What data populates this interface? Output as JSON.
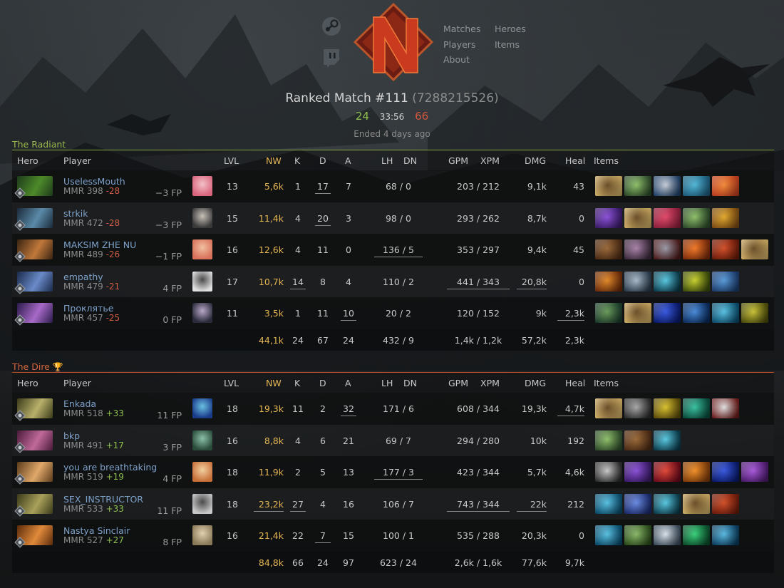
{
  "nav": {
    "left_icons": [
      "steam-icon",
      "twitch-icon"
    ],
    "col1": [
      "Matches",
      "Players",
      "About"
    ],
    "col2": [
      "Heroes",
      "Items"
    ]
  },
  "match": {
    "title_prefix": "Ranked Match #111",
    "match_id": "(7288215526)",
    "radiant_score": "24",
    "duration": "33:56",
    "dire_score": "66",
    "ended": "Ended 4 days ago"
  },
  "columns": {
    "hero": "Hero",
    "player": "Player",
    "lvl": "LVL",
    "nw": "NW",
    "k": "K",
    "d": "D",
    "a": "A",
    "lh": "LH",
    "dn": "DN",
    "gpm": "GPM",
    "xpm": "XPM",
    "dmg": "DMG",
    "heal": "Heal",
    "items": "Items"
  },
  "colors": {
    "radiant": "#8fbf4f",
    "dire": "#d0553f",
    "networth": "#e3b552",
    "player_link": "#7da0c9"
  },
  "teams": [
    {
      "key": "radiant",
      "name": "The Radiant",
      "winner": false,
      "players": [
        {
          "name": "UselessMouth",
          "mmr": "MMR 398",
          "delta": "-28",
          "fp": "−3 FP",
          "lvl": "13",
          "nw": "5,6k",
          "k": "1",
          "d": "17",
          "a": "7",
          "lhdn": "68 / 0",
          "gpmxpm": "203 / 212",
          "dmg": "9,1k",
          "heal": "43",
          "hero_colors": [
            "#1d3a1a",
            "#4d8a2a"
          ],
          "avatar_colors": [
            "#d9667d",
            "#f3c0c8"
          ],
          "items": [
            [
              "#c9a862",
              "#6b4f2a"
            ],
            [
              "#2d4a2a",
              "#8fbf6a"
            ],
            [
              "#1e3f66",
              "#c7ccd6"
            ],
            [
              "#1d5a7a",
              "#52b7d6"
            ],
            [
              "#b83c1e",
              "#f08a3a"
            ]
          ],
          "u": {
            "d": true
          }
        },
        {
          "name": "strkik",
          "mmr": "MMR 472",
          "delta": "-28",
          "fp": "−3 FP",
          "lvl": "15",
          "nw": "11,4k",
          "k": "4",
          "d": "20",
          "a": "3",
          "lhdn": "98 / 0",
          "gpmxpm": "293 / 262",
          "dmg": "8,7k",
          "heal": "0",
          "hero_colors": [
            "#1a2a3a",
            "#5a8aa8"
          ],
          "avatar_colors": [
            "#3a3a3a",
            "#c8c0b8"
          ],
          "items": [
            [
              "#3a1a66",
              "#8a52d6"
            ],
            [
              "#c9a862",
              "#6b4f2a"
            ],
            [
              "#8a1e3a",
              "#e04a6a"
            ],
            [
              "#2d4a2a",
              "#8fbf6a"
            ],
            [
              "#7a4a12",
              "#e0a830"
            ]
          ],
          "u": {
            "d": true
          }
        },
        {
          "name": "MAKSIM ZHE NU",
          "mmr": "MMR 489",
          "delta": "-26",
          "fp": "−1 FP",
          "lvl": "16",
          "nw": "12,6k",
          "k": "4",
          "d": "11",
          "a": "0",
          "lhdn": "136 / 5",
          "gpmxpm": "353 / 297",
          "dmg": "9,4k",
          "heal": "45",
          "hero_colors": [
            "#3a2412",
            "#c0783a"
          ],
          "avatar_colors": [
            "#d8705a",
            "#f1c0a0"
          ],
          "items": [
            [
              "#4a2a14",
              "#9a6a3a"
            ],
            [
              "#3a2a3a",
              "#a882a8"
            ],
            [
              "#4a1a1a",
              "#9a9aa8"
            ],
            [
              "#7a2a0a",
              "#f07a2a"
            ],
            [
              "#6a1a0a",
              "#d0502a"
            ],
            [
              "#c9a862",
              "#6b4f2a"
            ]
          ],
          "u": {
            "lh": true
          }
        },
        {
          "name": "empathy",
          "mmr": "MMR 479",
          "delta": "-21",
          "fp": "4 FP",
          "lvl": "17",
          "nw": "10,7k",
          "k": "14",
          "d": "8",
          "a": "4",
          "lhdn": "110 / 2",
          "gpmxpm": "441 / 343",
          "dmg": "20,8k",
          "heal": "0",
          "hero_colors": [
            "#1a2a4a",
            "#6a8ac8"
          ],
          "avatar_colors": [
            "#e0e0e0",
            "#4a4a4a"
          ],
          "items": [
            [
              "#6a2a0a",
              "#e08a2a"
            ],
            [
              "#2a3a4a",
              "#a8b8c8"
            ],
            [
              "#0a3a4a",
              "#5ac8e0"
            ],
            [
              "#3a4a0a",
              "#c8d030"
            ],
            [
              "#1a3a6a",
              "#5a9ad8"
            ]
          ],
          "u": {
            "k": true,
            "gpm": true,
            "dmg": true
          }
        },
        {
          "name": "Проклятье",
          "mmr": "MMR 457",
          "delta": "-25",
          "fp": "0 FP",
          "lvl": "11",
          "nw": "3,5k",
          "k": "1",
          "d": "11",
          "a": "10",
          "lhdn": "20 / 2",
          "gpmxpm": "120 / 152",
          "dmg": "9k",
          "heal": "2,3k",
          "hero_colors": [
            "#2a1a4a",
            "#a86ac8"
          ],
          "avatar_colors": [
            "#2a2a3a",
            "#b8a8c8"
          ],
          "items": [
            [
              "#1a3a2a",
              "#6a9a5a"
            ],
            [
              "#c9a862",
              "#6b4f2a"
            ],
            [
              "#0a1a6a",
              "#3a5ae0"
            ],
            [
              "#0a2a5a",
              "#4a8ad8"
            ],
            [
              "#0a4a6a",
              "#5ac0e0"
            ],
            [
              "#4a4a0a",
              "#c8c03a"
            ]
          ],
          "u": {
            "a": true,
            "heal": true
          }
        }
      ],
      "totals": {
        "nw": "44,1k",
        "k": "24",
        "d": "67",
        "a": "24",
        "lhdn": "432 / 9",
        "gpmxpm": "1,4k / 1,2k",
        "dmg": "57,2k",
        "heal": "2,3k"
      }
    },
    {
      "key": "dire",
      "name": "The Dire",
      "winner": true,
      "players": [
        {
          "name": "Enkada",
          "mmr": "MMR 518",
          "delta": "+33",
          "fp": "11 FP",
          "lvl": "18",
          "nw": "19,3k",
          "k": "11",
          "d": "2",
          "a": "32",
          "lhdn": "171 / 6",
          "gpmxpm": "608 / 344",
          "dmg": "19,3k",
          "heal": "4,7k",
          "hero_colors": [
            "#3a3a1a",
            "#b8b06a"
          ],
          "avatar_colors": [
            "#1a3a8a",
            "#6ac0e0"
          ],
          "items": [
            [
              "#c9a862",
              "#6b4f2a"
            ],
            [
              "#2a2a2a",
              "#a8a8a8"
            ],
            [
              "#5a4a0a",
              "#d8c030"
            ],
            [
              "#0a4a3a",
              "#3ac0a0"
            ],
            [
              "#6a1a1a",
              "#e0e0e0"
            ]
          ],
          "u": {
            "a": true,
            "heal": true
          }
        },
        {
          "name": "bkp",
          "mmr": "MMR 491",
          "delta": "+17",
          "fp": "3 FP",
          "lvl": "16",
          "nw": "8,8k",
          "k": "4",
          "d": "6",
          "a": "21",
          "lhdn": "69 / 7",
          "gpmxpm": "294 / 280",
          "dmg": "10k",
          "heal": "192",
          "hero_colors": [
            "#4a1a3a",
            "#c06a9a"
          ],
          "avatar_colors": [
            "#2a4a3a",
            "#8ac0a8"
          ],
          "items": [
            [
              "#2d4a2a",
              "#8fbf6a"
            ],
            [
              "#4a2a14",
              "#9a6a3a"
            ],
            [
              "#0a3a4a",
              "#5ac8e0"
            ]
          ],
          "u": {}
        },
        {
          "name": "you are breathtaking",
          "mmr": "MMR 519",
          "delta": "+19",
          "fp": "4 FP",
          "lvl": "18",
          "nw": "11,9k",
          "k": "2",
          "d": "5",
          "a": "13",
          "lhdn": "177 / 3",
          "gpmxpm": "423 / 344",
          "dmg": "5,7k",
          "heal": "4,6k",
          "hero_colors": [
            "#5a3a1a",
            "#e0a86a"
          ],
          "avatar_colors": [
            "#c8703a",
            "#f0d0a0"
          ],
          "items": [
            [
              "#2a2a2a",
              "#c8c8c8"
            ],
            [
              "#3a1a66",
              "#8a52d6"
            ],
            [
              "#6a0a1a",
              "#e04a3a"
            ],
            [
              "#7a3a0a",
              "#f0902a"
            ],
            [
              "#0a1a6a",
              "#3a5ae0"
            ],
            [
              "#4a1a6a",
              "#a85ad8"
            ]
          ],
          "u": {
            "lh": true
          }
        },
        {
          "name": "SEX_INSTRUCTOR",
          "mmr": "MMR 533",
          "delta": "+33",
          "fp": "11 FP",
          "lvl": "18",
          "nw": "23,2k",
          "k": "27",
          "d": "4",
          "a": "16",
          "lhdn": "106 / 7",
          "gpmxpm": "743 / 344",
          "dmg": "22k",
          "heal": "212",
          "hero_colors": [
            "#3a3a1a",
            "#a8a05a"
          ],
          "avatar_colors": [
            "#c8c8c8",
            "#4a4a4a"
          ],
          "items": [
            [
              "#0a4a6a",
              "#5ac0e0"
            ],
            [
              "#1a2a6a",
              "#6a8ae0"
            ],
            [
              "#0a3a4a",
              "#5ac8e0"
            ],
            [
              "#c9a862",
              "#6b4f2a"
            ],
            [
              "#6a1a0a",
              "#d0502a"
            ]
          ],
          "u": {
            "nw": true,
            "k": true,
            "gpm": true,
            "dmg": true
          }
        },
        {
          "name": "Nastya Sinclair",
          "mmr": "MMR 527",
          "delta": "+27",
          "fp": "8 FP",
          "lvl": "16",
          "nw": "21,4k",
          "k": "22",
          "d": "7",
          "a": "15",
          "lhdn": "100 / 1",
          "gpmxpm": "535 / 288",
          "dmg": "20,3k",
          "heal": "0",
          "hero_colors": [
            "#5a2a0a",
            "#e08a3a"
          ],
          "avatar_colors": [
            "#8a7a5a",
            "#e0d0b0"
          ],
          "items": [
            [
              "#0a4a6a",
              "#5ac0e0"
            ],
            [
              "#2a4a1a",
              "#8ab86a"
            ],
            [
              "#3a4a5a",
              "#d8e0e8"
            ],
            [
              "#0a4a2a",
              "#3ad07a"
            ],
            [
              "#0a3a5a",
              "#5ab8e0"
            ]
          ],
          "u": {
            "d": true
          }
        }
      ],
      "totals": {
        "nw": "84,8k",
        "k": "66",
        "d": "24",
        "a": "97",
        "lhdn": "623 / 24",
        "gpmxpm": "2,6k / 1,6k",
        "dmg": "77,6k",
        "heal": "9,7k"
      }
    }
  ]
}
